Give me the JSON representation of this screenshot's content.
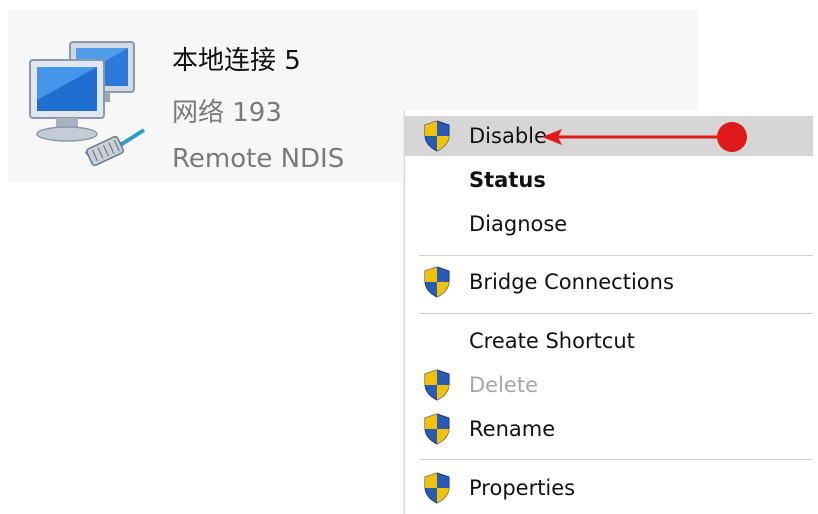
{
  "connection": {
    "name": "本地连接 5",
    "network": "网络  193",
    "device": "Remote NDIS",
    "icon": "network-computers-icon"
  },
  "menu": {
    "items": [
      {
        "label": "Disable",
        "icon": "uac-shield-icon",
        "highlighted": true
      },
      {
        "label": "Status",
        "bold": true
      },
      {
        "label": "Diagnose"
      },
      {
        "label": "Bridge Connections",
        "icon": "uac-shield-icon"
      },
      {
        "label": "Create Shortcut"
      },
      {
        "label": "Delete",
        "icon": "uac-shield-icon",
        "disabled": true
      },
      {
        "label": "Rename",
        "icon": "uac-shield-icon"
      },
      {
        "label": "Properties",
        "icon": "uac-shield-icon"
      }
    ]
  },
  "colors": {
    "menu_highlight": "#d6d6d6",
    "annotation": "#e0191b",
    "shield_blue": "#2a5ab8",
    "shield_yellow": "#f2c200"
  }
}
